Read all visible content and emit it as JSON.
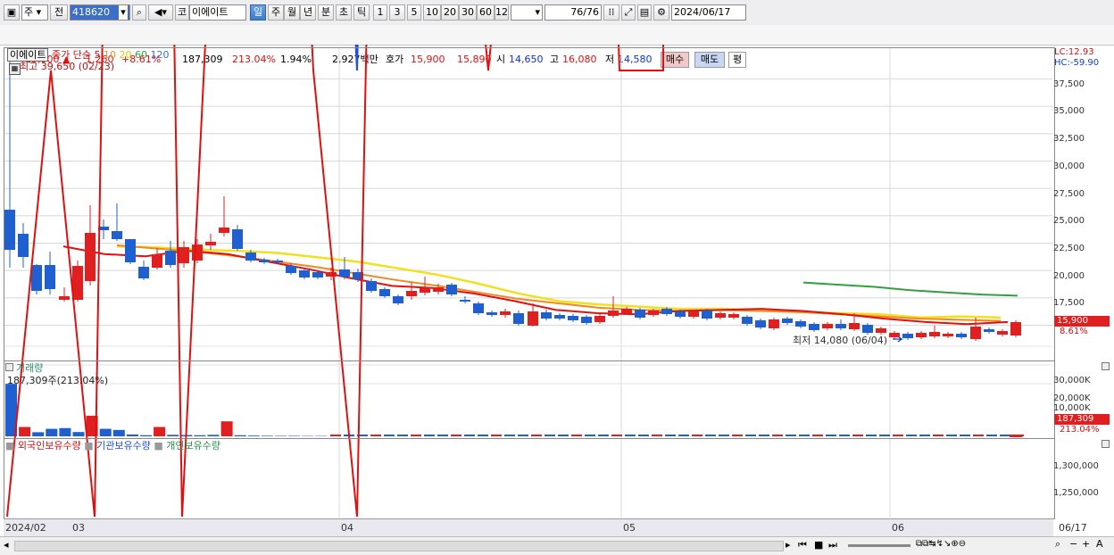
{
  "toolbar": {
    "market": "주",
    "prev": "전",
    "code": "418620",
    "name": "이에이트",
    "ko": "코",
    "periods": [
      "일",
      "주",
      "월",
      "년",
      "분",
      "초",
      "틱"
    ],
    "active_period": "일",
    "minutes": [
      "1",
      "3",
      "5",
      "10",
      "20",
      "30",
      "60",
      "120"
    ],
    "count": "76",
    "count_total": "/76",
    "date": "2024/06/17"
  },
  "quote": {
    "price": "15,900",
    "change": "1,260",
    "change_pct": "+8.61%",
    "volume": "187,309",
    "volume_ratio": "213.04%",
    "turnover": "1.94%",
    "amount": "2,927백만",
    "bid_label": "호가",
    "ask": "15,900",
    "bid": "15,890",
    "open_label": "시",
    "open": "14,650",
    "high_label": "고",
    "high": "16,080",
    "low_label": "저",
    "low": "14,580",
    "buy": "매수",
    "sell": "매도",
    "avg": "평"
  },
  "price_panel": {
    "name": "이에이트",
    "ma_label": "종가 단순",
    "ma_periods": [
      "5",
      "10",
      "20",
      "60",
      "120"
    ],
    "high_note": "최고 39,650 (02/23)",
    "low_note": "최저 14,080 (06/04)",
    "lc": "LC:12.93",
    "hc": "HC:-59.90",
    "y_ticks": [
      "37,500",
      "35,000",
      "32,500",
      "30,000",
      "27,500",
      "25,000",
      "22,500",
      "20,000",
      "17,500"
    ],
    "last_tag": "15,900",
    "last_pct": "8.61%"
  },
  "volume_panel": {
    "title": "거래량",
    "info": "187,309주(213.04%)",
    "y_ticks": [
      "30,000K",
      "20,000K",
      "10,000K"
    ],
    "last_tag": "187,309",
    "last_pct": "213.04%"
  },
  "holding_panel": {
    "legend": [
      "외국인보유수량",
      "기관보유수량",
      "개인보유수량"
    ],
    "y_ticks": [
      "1,300,000",
      "1,250,000"
    ]
  },
  "x_axis": {
    "labels": [
      "2024/02",
      "03",
      "04",
      "05",
      "06"
    ],
    "end": "06/17"
  },
  "colors": {
    "up": "#e02020",
    "down": "#1f5fd0",
    "ma5": "#e01010",
    "ma10": "#f08a20",
    "ma20": "#f0e020",
    "ma60": "#30a040",
    "ma120": "#3070d0"
  },
  "chart_data": [
    {
      "type": "candlestick",
      "title": "이에이트",
      "series": [
        {
          "name": "5",
          "values": [
            22200,
            21500,
            21300,
            21800,
            21500,
            20800,
            20100,
            19300,
            18600,
            18400,
            17900,
            17200,
            16400,
            16100,
            16000,
            16300,
            16400,
            16500,
            16300,
            16000,
            15600,
            15300,
            15100,
            15300
          ]
        },
        {
          "name": "10",
          "values": [
            22300,
            22000,
            21700,
            21300,
            20800,
            20300,
            19700,
            19100,
            18600,
            18000,
            17400,
            17000,
            16600,
            16400,
            16300,
            16400,
            16300,
            16200,
            16000,
            15800,
            15600,
            15500,
            15400
          ]
        },
        {
          "name": "20",
          "values": [
            22200,
            22100,
            21900,
            21800,
            21600,
            21200,
            20800,
            20200,
            19600,
            18800,
            17900,
            17200,
            16900,
            16700,
            16500,
            16500,
            16400,
            16200,
            16100,
            16000,
            15700,
            15800,
            15700
          ]
        },
        {
          "name": "60",
          "values": [
            18900,
            18700,
            18500,
            18200,
            18000,
            17800,
            17700
          ]
        }
      ],
      "ylim": [
        14000,
        39650
      ]
    },
    {
      "type": "bar",
      "title": "거래량",
      "values": [
        28000,
        5000,
        2200,
        4000,
        4400,
        2300,
        11000,
        4000,
        3400,
        1000,
        600,
        5000,
        800,
        700,
        600,
        800,
        8000,
        600,
        400,
        300,
        250,
        250,
        200,
        200
      ],
      "ylim": [
        0,
        36000
      ]
    },
    {
      "type": "line",
      "series": [
        {
          "name": "외국인보유수량",
          "values": [
            1225000,
            1226000,
            1225000,
            1231000,
            1225000,
            1227000,
            1228000,
            1226000,
            1225000,
            1230000,
            1227000,
            1226000,
            1227000,
            1229000,
            1226000,
            1226000,
            1295000,
            1270000,
            1255000,
            1275000,
            1255000,
            1289000,
            1282000,
            1240000
          ]
        },
        {
          "name": "기관보유수량",
          "values": [
            1300000,
            1295000,
            1287000,
            1300000,
            1299000,
            1294000,
            1290000,
            1228000,
            1226000,
            1230000,
            1243000,
            1250000,
            1252000,
            1250000,
            1230000,
            1233000,
            1231000,
            1232000,
            1235000,
            1237000,
            1240000,
            1245000,
            1243000,
            1235000
          ]
        },
        {
          "name": "개인보유수량",
          "values": [
            1265000,
            1296000,
            1250000,
            1285000,
            1272000,
            1255000,
            1240000,
            1318000,
            1305000,
            1305000,
            1318000,
            1300000,
            1310000,
            1292000,
            1300000,
            1278000,
            1230000,
            1262000,
            1288000,
            1275000,
            1270000,
            1287000,
            1262000,
            1230000
          ]
        }
      ]
    }
  ]
}
